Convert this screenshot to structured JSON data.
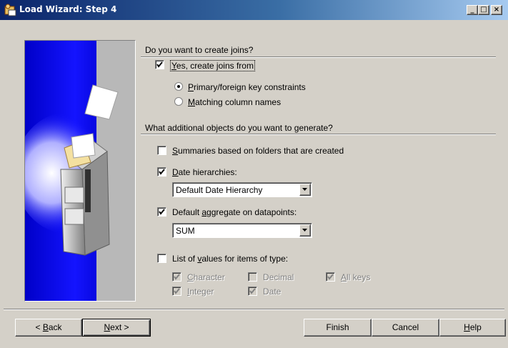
{
  "window": {
    "title": "Load Wizard: Step 4",
    "controls": {
      "minimize": "_",
      "maximize": "□",
      "close": "×"
    }
  },
  "joins": {
    "question": "Do you want to create joins?",
    "create_joins": {
      "label_key": "Y",
      "label_rest": "es, create joins from",
      "checked": true
    },
    "options": [
      {
        "label_key": "P",
        "label_rest": "rimary/foreign key constraints",
        "selected": true
      },
      {
        "label_key": "M",
        "label_rest": "atching column names",
        "selected": false
      }
    ]
  },
  "objects": {
    "question": "What additional objects do you want to generate?",
    "summaries": {
      "label_key": "S",
      "label_rest": "ummaries based on folders that are created",
      "checked": false
    },
    "date_hierarchies": {
      "label_key": "D",
      "label_rest": "ate hierarchies:",
      "checked": true,
      "selected": "Default Date Hierarchy"
    },
    "default_aggregate": {
      "label_pre": "Default ",
      "label_key": "a",
      "label_rest": "ggregate on datapoints:",
      "checked": true,
      "selected": "SUM"
    },
    "list_of_values": {
      "label_pre": "List of ",
      "label_key": "v",
      "label_rest": "alues for items of type:",
      "checked": false
    },
    "types": {
      "character": {
        "label_key": "C",
        "label_rest": "haracter",
        "checked": true
      },
      "decimal": {
        "label_key": "",
        "label_rest": "Decimal",
        "checked": false
      },
      "all_keys": {
        "label_key": "A",
        "label_rest": "ll keys",
        "checked": true
      },
      "integer": {
        "label_key": "I",
        "label_rest": "nteger",
        "checked": true
      },
      "date": {
        "label_key": "",
        "label_rest": "Date",
        "checked": true
      }
    }
  },
  "buttons": {
    "back": {
      "label_pre": "< ",
      "label_key": "B",
      "label_rest": "ack"
    },
    "next": {
      "label_key": "N",
      "label_rest": "ext >"
    },
    "finish": "Finish",
    "cancel": "Cancel",
    "help": {
      "label_key": "H",
      "label_rest": "elp"
    }
  },
  "colors": {
    "accent": "#0a246a",
    "dialog_bg": "#d4d0c8",
    "banner_blue": "#1010f0"
  },
  "icons": {
    "title": "load-wizard-icon",
    "banner": "database-box-illustration"
  }
}
